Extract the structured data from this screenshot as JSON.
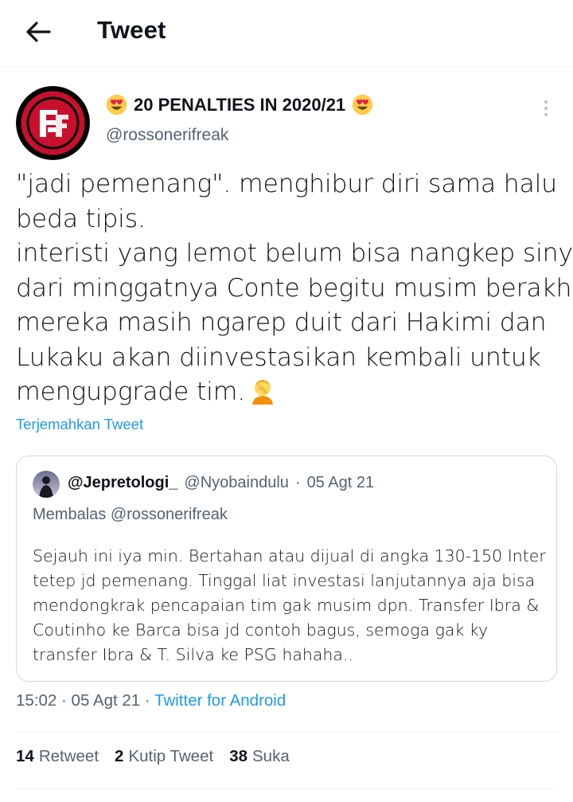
{
  "header": {
    "title": "Tweet",
    "back_icon": "arrow-left-icon"
  },
  "author": {
    "name": "20 PENALTIES IN 2020/21",
    "name_emoji": "heart-eyes-emoji",
    "handle": "@rossonerifreak",
    "avatar_colors": {
      "ring": "#c8102e",
      "inner": "#000000"
    }
  },
  "tweet": {
    "lines": [
      "\"jadi pemenang\". menghibur diri sama halu",
      "beda tipis.",
      "interisti yang lemot belum bisa nangkep sinyal",
      "dari minggatnya Conte begitu musim berakhir.",
      "mereka masih ngarep duit dari Hakimi dan",
      "Lukaku akan diinvestasikan kembali untuk",
      "mengupgrade tim."
    ],
    "trailing_emoji": "facepalm-emoji",
    "translate_label": "Terjemahkan Tweet"
  },
  "quote": {
    "name": "@Jepretologi_",
    "handle": "@Nyobaindulu",
    "separator": "·",
    "date": "05 Agt 21",
    "reply_to": "Membalas @rossonerifreak",
    "lines": [
      "Sejauh ini iya min. Bertahan atau dijual di angka 130-150 Inter",
      "tetep jd pemenang. Tinggal liat investasi lanjutannya aja bisa",
      "mendongkrak pencapaian tim gak musim dpn. Transfer Ibra &",
      "Coutinho ke Barca bisa jd contoh bagus, semoga gak ky",
      "transfer Ibra & T. Silva ke PSG hahaha.."
    ]
  },
  "meta": {
    "time": "15:02",
    "separator": "·",
    "date": "05 Agt 21",
    "source": "Twitter for Android"
  },
  "stats": [
    {
      "count": "14",
      "label": "Retweet"
    },
    {
      "count": "2",
      "label": "Kutip Tweet"
    },
    {
      "count": "38",
      "label": "Suka"
    }
  ],
  "colors": {
    "accent": "#1d9bf0",
    "secondary_text": "#536471",
    "border": "#cfd9de"
  }
}
